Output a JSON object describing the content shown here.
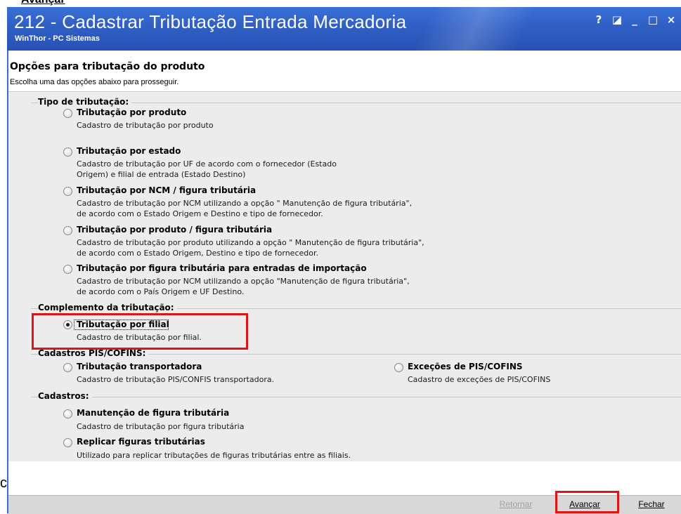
{
  "top_crop_text": "Avançar",
  "window": {
    "title": "212 - Cadastrar Tributação Entrada Mercadoria",
    "subtitle": "WinThor - PC Sistemas",
    "controls": {
      "help": "?",
      "minimize": "_",
      "maximize": "□",
      "close": "×",
      "dock": "◪"
    }
  },
  "header": {
    "title": "Opções para tributação do produto",
    "subtitle": "Escolha uma das opções abaixo para prosseguir."
  },
  "groups": {
    "tipo": {
      "label": "Tipo de tributação:",
      "options": [
        {
          "title": "Tributação por produto",
          "desc": [
            "Cadastro de tributação por produto"
          ]
        },
        {
          "title": "Tributação por estado",
          "desc": [
            "Cadastro de tributação por UF de acordo com o fornecedor (Estado",
            "Origem) e filial de entrada (Estado Destino)"
          ]
        },
        {
          "title": "Tributação por NCM / figura tributária",
          "desc": [
            "Cadastro de tributação por NCM utilizando a opção \" Manutenção de figura tributária\",",
            "de acordo com o Estado Origem e Destino e tipo de fornecedor."
          ]
        },
        {
          "title": "Tributação por produto / figura tributária",
          "desc": [
            "Cadastro de tributação por produto utilizando a opção \" Manutenção de figura tributária\",",
            "de acordo com o Estado Origem, Destino e tipo de fornecedor."
          ]
        },
        {
          "title": "Tributação por figura tributária para entradas de importação",
          "desc": [
            "Cadastro de tributação por NCM utilizando a opção \"Manutenção de figura tributária\",",
            "de acordo com o País Origem e UF Destino."
          ]
        }
      ]
    },
    "complemento": {
      "label": "Complemento da tributação:",
      "option": {
        "title": "Tributação por filial",
        "desc": "Cadastro de tributação por filial.",
        "selected": true
      }
    },
    "pis": {
      "label": "Cadastros PIS/COFINS:",
      "options": [
        {
          "title": "Tributação  transportadora",
          "desc": "Cadastro de tributação PIS/CONFIS transportadora."
        },
        {
          "title": "Exceções de PIS/COFINS",
          "desc": "Cadastro de exceções de PIS/COFINS"
        }
      ]
    },
    "cadastros": {
      "label": "Cadastros:",
      "options": [
        {
          "title": "Manutenção de figura tributária",
          "desc": "Cadastro de tributação por figura tributária"
        },
        {
          "title": "Replicar figuras tributárias",
          "desc": "Utilizado para replicar tributações de figuras tributárias entre as filiais."
        }
      ]
    }
  },
  "footer": {
    "retornar": "Retornar",
    "avancar": "Avançar",
    "fechar": "Fechar"
  },
  "left_edge_char": "c",
  "colors": {
    "titlebar": "#2f5fc4",
    "content_bg": "#ececec",
    "highlight": "#e01414",
    "disabled_text": "#a3a3a3"
  }
}
